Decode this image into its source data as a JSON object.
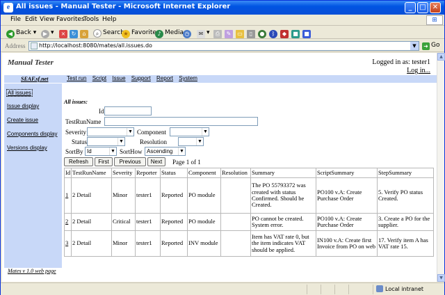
{
  "window": {
    "title": "All issues - Manual Tester - Microsoft Internet Explorer"
  },
  "menu": [
    "File",
    "Edit",
    "View",
    "Favorites",
    "Tools",
    "Help"
  ],
  "toolbar": {
    "back": "Back",
    "search": "Search",
    "favorites": "Favorites",
    "media": "Media"
  },
  "address": {
    "label": "Address",
    "url": "http://localhost:8080/mates/all.issues.do",
    "go": "Go"
  },
  "status": {
    "zone": "Local intranet"
  },
  "header": {
    "app_title": "Manual Tester",
    "logged_in": "Logged in as: tester1",
    "logout": "Log in..."
  },
  "nav": {
    "brand": "SEAF.sf.net",
    "tabs": [
      "Test run",
      "Script",
      "Issue",
      "Support",
      "Report",
      "System"
    ]
  },
  "sidebar": {
    "items": [
      "All issues",
      "Issue display",
      "Create issue",
      "Components display",
      "Versions display"
    ]
  },
  "footer": "Mates v 1.0 web page",
  "filters": {
    "section_title": "All issues:",
    "id_label": "Id",
    "testrunname_label": "TestRunName",
    "severity_label": "Severity",
    "component_label": "Component",
    "status_label": "Status",
    "resolution_label": "Resolution",
    "sortby_label": "SortBy",
    "sortby_value": "Id",
    "sorthow_label": "SortHow",
    "sorthow_value": "Ascending"
  },
  "buttons": {
    "refresh": "Refresh",
    "first": "First",
    "previous": "Previous",
    "next": "Next"
  },
  "page_info": "Page 1 of 1",
  "table": {
    "headers": [
      "Id",
      "TestRunName",
      "Severity",
      "Reporter",
      "Status",
      "Component",
      "Resolution",
      "Summary",
      "ScriptSummary",
      "StepSummary"
    ],
    "rows": [
      [
        "1",
        "2 Detail",
        "Minor",
        "tester1",
        "Reported",
        "PO module",
        "",
        "The PO 55793372 was created with status Confirmed. Should be Created.",
        "PO100 v.A: Create Purchase Order",
        "5. Verify PO status Created."
      ],
      [
        "2",
        "2 Detail",
        "Critical",
        "tester1",
        "Reported",
        "PO module",
        "",
        "PO cannot be created. System error.",
        "PO100 v.A: Create Purchase Order",
        "3. Create a PO for the supplier."
      ],
      [
        "3",
        "2 Detail",
        "Minor",
        "tester1",
        "Reported",
        "INV module",
        "",
        "Item has VAT rate 0, but the item indicates VAT should be applied.",
        "IN100 v.A: Create first Invoice from PO on web",
        "17. Verify item A has VAT rate 15."
      ]
    ]
  }
}
